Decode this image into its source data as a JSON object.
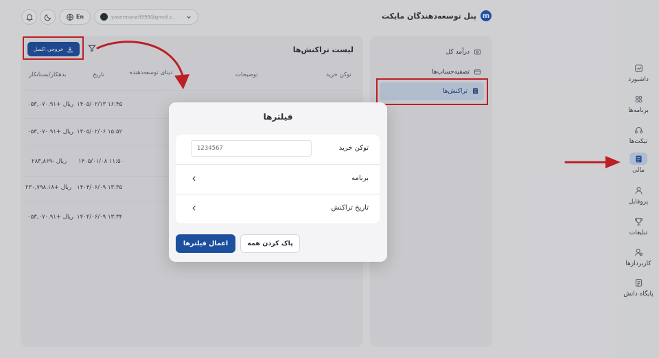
{
  "header": {
    "brand_letter": "m",
    "brand_title": "پنل توسعه‌دهندگان مایکت",
    "user_email": "yasermanafi999@gmail.c...",
    "lang": "En"
  },
  "rail": {
    "items": [
      {
        "label": "داشبورد",
        "icon": "dashboard-icon"
      },
      {
        "label": "برنامه‌ها",
        "icon": "apps-grid-icon"
      },
      {
        "label": "تیکت‌ها",
        "icon": "headset-icon"
      },
      {
        "label": "مالی",
        "icon": "wallet-icon"
      },
      {
        "label": "پروفایل",
        "icon": "profile-icon"
      },
      {
        "label": "تبلیغات",
        "icon": "trophy-icon"
      },
      {
        "label": "کاربردازها",
        "icon": "users-icon"
      },
      {
        "label": "پایگاه دانش",
        "icon": "document-icon"
      }
    ]
  },
  "side_menu": {
    "items": [
      {
        "label": "درآمد کل",
        "icon": "income-icon"
      },
      {
        "label": "تصفیه‌حساب‌ها",
        "icon": "card-icon"
      },
      {
        "label": "تراکنش‌ها",
        "icon": "list-icon"
      }
    ]
  },
  "transactions": {
    "title": "لیست تراکنش‌ها",
    "excel_label": "خروجی اکسل",
    "columns": {
      "token": "توکن خرید",
      "description": "توضیحات",
      "dev_data": "دیتای توسعه‌دهنده",
      "date": "تاریخ",
      "amount": "بدهکار/بستانکار"
    },
    "rows": [
      {
        "date": "۱۴۰۵/۰۲/۱۳ ۱۶:۴۵",
        "amount": "۰۵۳,۰۷۰.۹۱+ ریال"
      },
      {
        "date": "۱۴۰۵/۰۲/۰۶ ۱۵:۵۲",
        "amount": "۰۵۳,۰۷۰.۹۱+ ریال"
      },
      {
        "date": "۱۴۰۵/۰۱/۰۸ ۱۱:۵۰",
        "amount": "۲۸۳,۸۶۹- ریال"
      },
      {
        "date": "۱۴۰۴/۰۶/۰۹ ۱۳:۳۵",
        "amount": "۲۳۰,۷۹۸.۱۸+ ریال"
      },
      {
        "date": "۱۴۰۴/۰۶/۰۹ ۱۳:۳۴",
        "amount": "۰۵۳,۰۷۰.۹۱+ ریال"
      }
    ]
  },
  "filter_modal": {
    "title": "فیلترها",
    "token_label": "توکن خرید",
    "token_placeholder": "1234567",
    "app_label": "برنامه",
    "date_label": "تاریخ تراکنش",
    "apply_label": "اعمال فیلترها",
    "clear_label": "پاک کردن همه"
  },
  "colors": {
    "primary": "#1d4f9f",
    "highlight_box": "#d31f24"
  }
}
